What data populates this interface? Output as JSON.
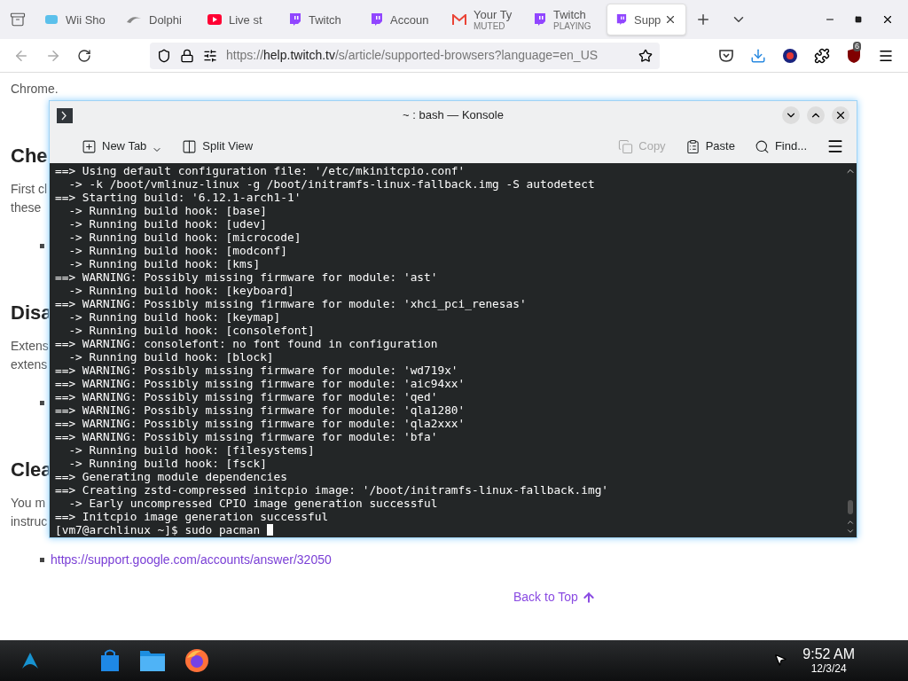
{
  "browser": {
    "tabs": [
      {
        "kind": "wii",
        "title": "Wii Sho",
        "selected": false
      },
      {
        "kind": "dolphin",
        "title": "Dolphi",
        "selected": false
      },
      {
        "kind": "youtube",
        "title": "Live st",
        "selected": false
      },
      {
        "kind": "twitch",
        "title": "Twitch",
        "selected": false
      },
      {
        "kind": "twitch",
        "title": "Accoun",
        "selected": false
      },
      {
        "kind": "gmail",
        "title": "Your Ty",
        "subtitle": "MUTED",
        "selected": false
      },
      {
        "kind": "twitch",
        "title": "Twitch",
        "subtitle": "PLAYING",
        "selected": false
      },
      {
        "kind": "twitch",
        "title": "Supp",
        "selected": true
      }
    ],
    "url": {
      "scheme": "https://",
      "domain": "help.twitch.tv",
      "path": "/s/article/supported-browsers?language=en_US"
    },
    "extension_badge": "6"
  },
  "page": {
    "items": [
      {
        "kind": "text",
        "text": "Chrome."
      },
      {
        "kind": "heading",
        "text": "Che"
      },
      {
        "kind": "text",
        "text": "First cl"
      },
      {
        "kind": "text",
        "text": "these"
      },
      {
        "kind": "bullet"
      },
      {
        "kind": "heading",
        "text": "Disa"
      },
      {
        "kind": "text",
        "text": "Extens"
      },
      {
        "kind": "text",
        "text": "extens"
      },
      {
        "kind": "bullet"
      },
      {
        "kind": "heading",
        "text": "Clea"
      },
      {
        "kind": "text",
        "text": "You m"
      },
      {
        "kind": "text",
        "text": "instruc"
      },
      {
        "kind": "link",
        "text": "https://support.google.com/accounts/answer/32050"
      },
      {
        "kind": "back",
        "text": "Back to Top"
      }
    ]
  },
  "konsole": {
    "title": "~ : bash — Konsole",
    "toolbar": [
      {
        "kind": "newtab",
        "label": "New Tab",
        "disabled": false
      },
      {
        "kind": "split",
        "label": "Split View",
        "disabled": false
      },
      {
        "kind": "copy",
        "label": "Copy",
        "disabled": true
      },
      {
        "kind": "paste",
        "label": "Paste",
        "disabled": false
      },
      {
        "kind": "find",
        "label": "Find...",
        "disabled": false
      }
    ],
    "lines": [
      "==> Using default configuration file: '/etc/mkinitcpio.conf'",
      "  -> -k /boot/vmlinuz-linux -g /boot/initramfs-linux-fallback.img -S autodetect",
      "==> Starting build: '6.12.1-arch1-1'",
      "  -> Running build hook: [base]",
      "  -> Running build hook: [udev]",
      "  -> Running build hook: [microcode]",
      "  -> Running build hook: [modconf]",
      "  -> Running build hook: [kms]",
      "==> WARNING: Possibly missing firmware for module: 'ast'",
      "  -> Running build hook: [keyboard]",
      "==> WARNING: Possibly missing firmware for module: 'xhci_pci_renesas'",
      "  -> Running build hook: [keymap]",
      "  -> Running build hook: [consolefont]",
      "==> WARNING: consolefont: no font found in configuration",
      "  -> Running build hook: [block]",
      "==> WARNING: Possibly missing firmware for module: 'wd719x'",
      "==> WARNING: Possibly missing firmware for module: 'aic94xx'",
      "==> WARNING: Possibly missing firmware for module: 'qed'",
      "==> WARNING: Possibly missing firmware for module: 'qla1280'",
      "==> WARNING: Possibly missing firmware for module: 'qla2xxx'",
      "==> WARNING: Possibly missing firmware for module: 'bfa'",
      "  -> Running build hook: [filesystems]",
      "  -> Running build hook: [fsck]",
      "==> Generating module dependencies",
      "==> Creating zstd-compressed initcpio image: '/boot/initramfs-linux-fallback.img'",
      "  -> Early uncompressed CPIO image generation successful",
      "==> Initcpio image generation successful"
    ],
    "prompt": "[vm7@archlinux ~]$ sudo pacman "
  },
  "taskbar": {
    "apps": [
      {
        "kind": "store"
      },
      {
        "kind": "files"
      },
      {
        "kind": "firefox"
      }
    ],
    "time": "9:52 AM",
    "date": "12/3/24"
  }
}
